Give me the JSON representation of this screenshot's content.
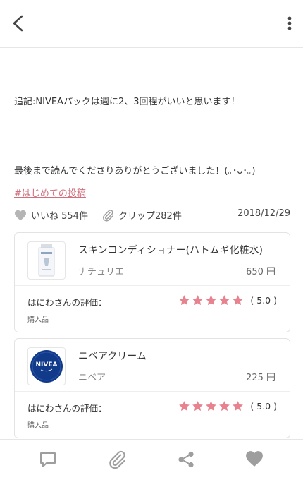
{
  "article": {
    "note_line": "追記:NIVEAパックは週に2、3回程がいいと思います！",
    "closing_line": "最後まで読んでくださりありがとうございました！(｡･ᴗ･｡)",
    "hashtag": "#はじめての投稿"
  },
  "meta": {
    "like_label": "いいね 554件",
    "clip_label": "クリップ282件",
    "date": "2018/12/29"
  },
  "products": [
    {
      "name": "スキンコンディショナー(ハトムギ化粧水)",
      "brand": "ナチュリエ",
      "price": "650 円",
      "rating_label": "はにわさんの評価：",
      "rating_score": "( 5.0 )",
      "rating_value": 5.0,
      "purchase": "購入品",
      "thumb_icon": "lotion-bottle-image"
    },
    {
      "name": "ニベアクリーム",
      "brand": "ニベア",
      "price": "225 円",
      "rating_label": "はにわさんの評価：",
      "rating_score": "( 5.0 )",
      "rating_value": 5.0,
      "purchase": "購入品",
      "thumb_icon": "nivea-tin-image",
      "thumb_logo_text": "NIVEA"
    }
  ],
  "icons": {
    "back": "back-arrow-icon",
    "menu": "more-vertical-icon",
    "like": "heart-icon",
    "clip": "paperclip-icon",
    "comment": "comment-icon",
    "share": "share-icon"
  },
  "colors": {
    "accent": "#d16f7e",
    "star": "#e8828f",
    "icon_gray": "#9e9e9e",
    "nivea_blue": "#123a8a"
  }
}
